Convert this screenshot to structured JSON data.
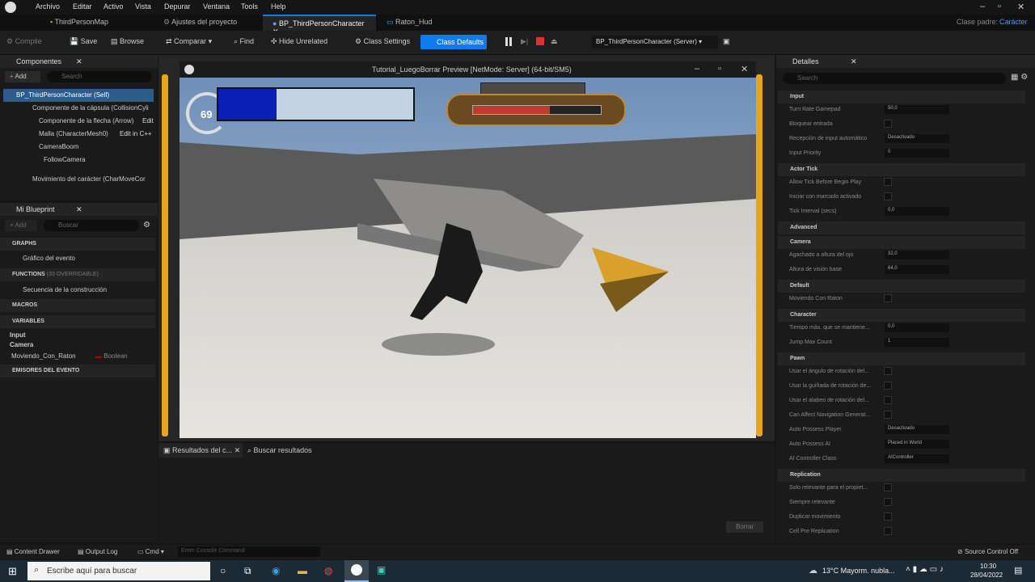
{
  "menu": [
    "Archivo",
    "Editar",
    "Activo",
    "Vista",
    "Depurar",
    "Ventana",
    "Tools",
    "Help"
  ],
  "parent_class": {
    "label": "Clase padre:",
    "value": "Carácter"
  },
  "tabs": [
    "ThirdPersonMap",
    "Ajustes del proyecto",
    "BP_ThirdPersonCharacter",
    "Raton_Hud"
  ],
  "toolbar": {
    "compile": "Compile",
    "save": "Save",
    "browse": "Browse",
    "compare": "Comparar",
    "find": "Find",
    "hide_unrelated": "Hide Unrelated",
    "class_settings": "Class Settings",
    "class_defaults": "Class Defaults",
    "debug_target": "BP_ThirdPersonCharacter (Server)"
  },
  "components": {
    "title": "Componentes",
    "add": "Add",
    "search_placeholder": "Search",
    "items": [
      "BP_ThirdPersonCharacter (Self)",
      "Componente de la cápsula (CollisionCyli",
      "Componente de la flecha (Arrow)",
      "Malla (CharacterMesh0)",
      "CameraBoom",
      "FollowCamera",
      "Movimiento del carácter (CharMoveCor"
    ],
    "edit": "Edit",
    "edit_cpp": "Edit in C++"
  },
  "blueprint": {
    "title": "Mi Blueprint",
    "add": "Add",
    "search_placeholder": "Buscar",
    "graphs": "GRAPHS",
    "graph_item": "Gráfico del evento",
    "functions": "FUNCTIONS",
    "functions_note": "(33 OVERRIDABLE)",
    "function_item": "Secuencia de la construcción",
    "macros": "MACROS",
    "variables": "VARIABLES",
    "var_groups": [
      "Input",
      "Camera"
    ],
    "var_name": "Moviendo_Con_Raton",
    "var_type": "Boolean",
    "dispatchers": "EMISORES DEL EVENTO"
  },
  "preview": {
    "title": "Tutorial_LuegoBorrar Preview [NetMode: Server]  (64-bit/SM5)",
    "hud_number": "69",
    "player_bar_fill": 0.3,
    "enemy_bar_fill": 0.6
  },
  "results": {
    "tab1": "Resultados del c...",
    "tab2": "Buscar resultados",
    "clear": "Borrar"
  },
  "details": {
    "title": "Detalles",
    "search_placeholder": "Search",
    "sections": [
      {
        "name": "Input",
        "rows": [
          [
            "Turn Rate Gamepad",
            "50,0"
          ],
          [
            "Bloquear entrada",
            ""
          ],
          [
            "Recepción de input automático",
            "Desactivado"
          ],
          [
            "Input Priority",
            "0"
          ]
        ]
      },
      {
        "name": "Actor Tick",
        "rows": [
          [
            "Allow Tick Before Begin Play",
            ""
          ],
          [
            "Iniciar con marcado activado",
            ""
          ],
          [
            "Tick Interval (secs)",
            "0,0"
          ]
        ]
      },
      {
        "name": "Advanced",
        "rows": []
      },
      {
        "name": "Camera",
        "rows": [
          [
            "Agachado a altura del ojo",
            "32,0"
          ],
          [
            "Altura de visión base",
            "64,0"
          ]
        ]
      },
      {
        "name": "Default",
        "rows": [
          [
            "Moviendo Con Raton",
            ""
          ]
        ]
      },
      {
        "name": "Character",
        "rows": [
          [
            "Tiempo máx. que se mantiene...",
            "0,0"
          ],
          [
            "Jump Max Count",
            "1"
          ]
        ]
      },
      {
        "name": "Pawn",
        "rows": [
          [
            "Usar el ángulo de rotación del...",
            ""
          ],
          [
            "Usar la guiñada de rotación de...",
            ""
          ],
          [
            "Usar el alabeo de rotación del...",
            ""
          ],
          [
            "Can Affect Navigation Generat...",
            ""
          ],
          [
            "Auto Possess Player",
            "Desactivado"
          ],
          [
            "Auto Possess AI",
            "Placed in World"
          ],
          [
            "AI Controller Class",
            "AIController"
          ]
        ]
      },
      {
        "name": "Replication",
        "rows": [
          [
            "Solo relevante para el propiet...",
            ""
          ],
          [
            "Siempre relevante",
            ""
          ],
          [
            "Duplicar movimiento",
            ""
          ],
          [
            "Cell Pre Replication",
            ""
          ]
        ]
      }
    ]
  },
  "status": {
    "content_drawer": "Content Drawer",
    "output_log": "Output Log",
    "cmd": "Cmd",
    "console_placeholder": "Enter Console Command",
    "source_control": "Source Control Off"
  },
  "taskbar": {
    "search_placeholder": "Escribe aquí para buscar",
    "weather": "13°C  Mayorm. nubla...",
    "time": "10:30",
    "date": "28/04/2022"
  }
}
